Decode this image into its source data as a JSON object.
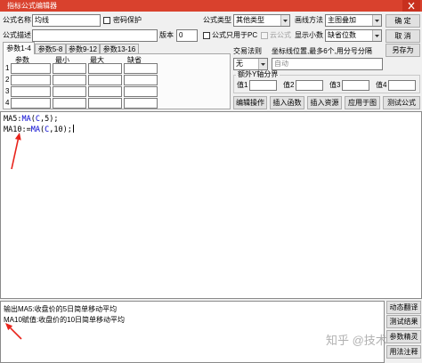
{
  "window": {
    "title": "指标公式编辑器"
  },
  "icons": {
    "close": "close-icon",
    "dropdown": "chevron-down-icon",
    "annotation": "red-arrow-icon"
  },
  "colors": {
    "title_bar": "#d9412d",
    "close_button": "#c8301e",
    "annotation": "#e8231b",
    "function_token": "#0000d0"
  },
  "header": {
    "name_label": "公式名称",
    "name_value": "均线",
    "password": {
      "label": "密码保护",
      "checked": false
    },
    "type_label": "公式类型",
    "type_value": "其他类型",
    "draw_label": "画线方法",
    "draw_value": "主图叠加",
    "desc_label": "公式描述",
    "desc_value": "",
    "version_label": "版本",
    "version_value": "0",
    "pc_only": {
      "label": "公式只用于PC",
      "checked": false
    },
    "cloud": {
      "label": "云公式",
      "checked": false,
      "disabled": true
    },
    "decimals_label": "显示小数",
    "decimals_value": "缺省位数"
  },
  "actions": {
    "ok": "确 定",
    "cancel": "取 消",
    "save_as": "另存为"
  },
  "param_tabs": [
    {
      "label": "参数1-4",
      "active": true
    },
    {
      "label": "参数5-8",
      "active": false
    },
    {
      "label": "参数9-12",
      "active": false
    },
    {
      "label": "参数13-16",
      "active": false
    }
  ],
  "params": {
    "headers": [
      "参数",
      "最小",
      "最大",
      "缺省"
    ],
    "rows": [
      {
        "index": "1",
        "name": "",
        "min": "",
        "max": "",
        "default": ""
      },
      {
        "index": "2",
        "name": "",
        "min": "",
        "max": "",
        "default": ""
      },
      {
        "index": "3",
        "name": "",
        "min": "",
        "max": "",
        "default": ""
      },
      {
        "index": "4",
        "name": "",
        "min": "",
        "max": "",
        "default": ""
      }
    ]
  },
  "trade_rule": {
    "label": "交易法则",
    "value": "无"
  },
  "coord_lines": {
    "label": "坐标线位置,最多6个,用分号分隔",
    "value": "自动"
  },
  "extra_y_axis": {
    "title": "额外Y轴分界",
    "values": [
      {
        "label": "值1",
        "value": ""
      },
      {
        "label": "值2",
        "value": ""
      },
      {
        "label": "值3",
        "value": ""
      },
      {
        "label": "值4",
        "value": ""
      }
    ]
  },
  "toolbar": [
    "编辑操作",
    "插入函数",
    "插入资源",
    "应用于图",
    "测试公式"
  ],
  "editor": {
    "lines": [
      {
        "tokens": [
          "MA5:",
          "MA",
          "(",
          "C",
          ",5);"
        ]
      },
      {
        "tokens": [
          "MA10:=",
          "MA",
          "(",
          "C",
          ",10);"
        ]
      }
    ]
  },
  "output": {
    "lines": [
      "输出MA5:收盘价的5日简单移动平均",
      "MA10赋值:收盘价的10日简单移动平均"
    ]
  },
  "side_buttons": [
    "动态翻译",
    "测试结果",
    "参数精灵",
    "用法注释"
  ],
  "watermark": "知乎 @技术"
}
